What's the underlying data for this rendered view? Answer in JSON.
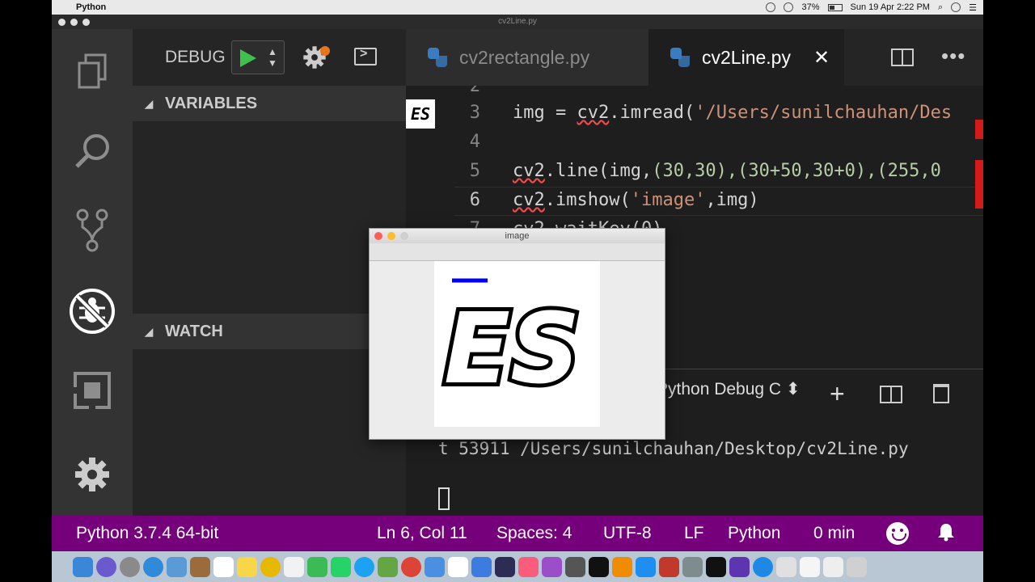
{
  "menubar": {
    "app_name": "Python",
    "battery": "37%",
    "datetime": "Sun 19 Apr  2:22 PM"
  },
  "window": {
    "title": "cv2Line.py"
  },
  "sidebar": {
    "debug_label": "DEBUG",
    "sections": {
      "variables": "VARIABLES",
      "watch": "WATCH"
    }
  },
  "tabs": [
    {
      "label": "cv2rectangle.py",
      "active": false
    },
    {
      "label": "cv2Line.py",
      "active": true
    }
  ],
  "editor": {
    "line_numbers": [
      "2",
      "3",
      "4",
      "5",
      "6",
      "7"
    ],
    "lines": {
      "l3_prefix": "img = ",
      "l3_mod": "cv2",
      "l3_fn": ".imread(",
      "l3_str": "'/Users/sunilchauhan/Des",
      "l5_mod": "cv2",
      "l5_fn": ".line(img,",
      "l5_args": "(30,30),(30+50,30+0),(255,0",
      "l6_mod": "cv2",
      "l6_fn": ".imshow(",
      "l6_str": "'image'",
      "l6_rest": ",img)",
      "l7": "cv2.waitKey(0)"
    },
    "thumbnail_text": "ES"
  },
  "panel": {
    "console_select": "Python Debug C",
    "terminal_text": "t 53911 /Users/sunilchauhan/Desktop/cv2Line.py"
  },
  "statusbar": {
    "python": "Python 3.7.4 64-bit",
    "position": "Ln 6, Col 11",
    "spaces": "Spaces: 4",
    "encoding": "UTF-8",
    "eol": "LF",
    "language": "Python",
    "time": "0 min"
  },
  "image_window": {
    "title": "image",
    "line_color": "#0000ff",
    "content": "ES"
  },
  "colors": {
    "statusbar_bg": "#76007b",
    "activity_bg": "#333333",
    "sidebar_bg": "#252526",
    "editor_bg": "#1e1e1e",
    "run_green": "#3fc24d"
  }
}
